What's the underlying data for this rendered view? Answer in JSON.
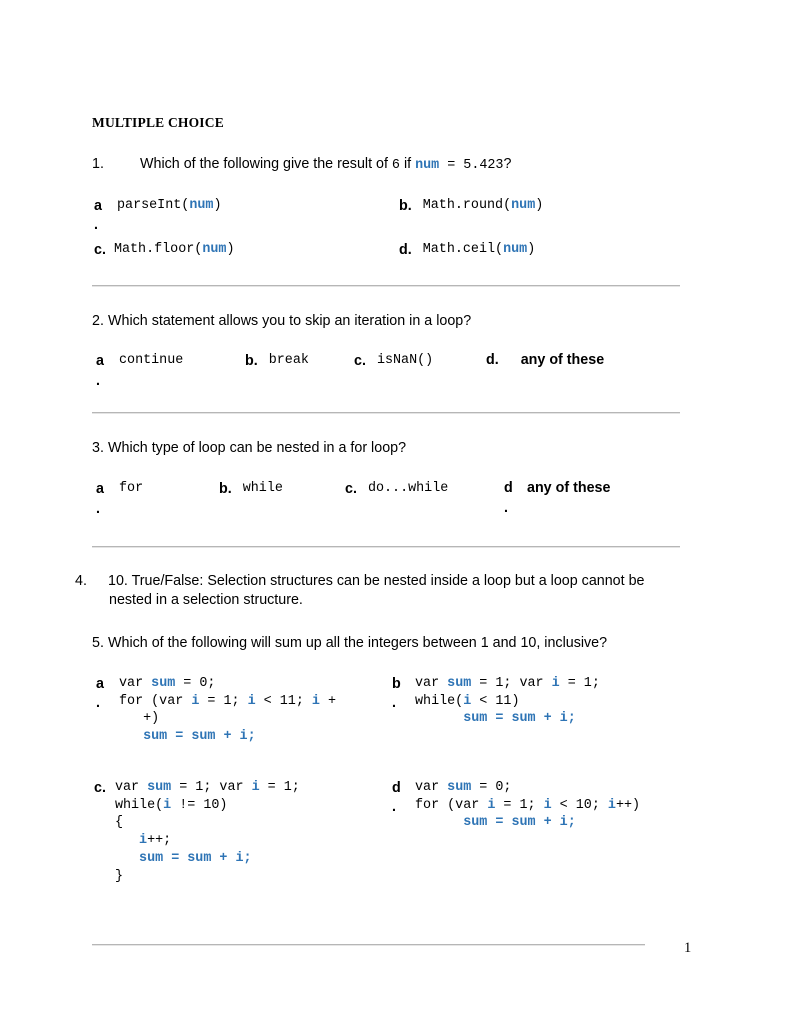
{
  "document": {
    "heading": "MULTIPLE CHOICE",
    "page_number": "1",
    "accent_color": "#2E74B5",
    "rule_color": "#b6b6b6"
  },
  "questions": [
    {
      "number": "1.",
      "prompt_parts": {
        "p1": "Which of the following give the result of ",
        "mono1": "6",
        "p2": "  if ",
        "kw1": "num",
        "mono2": " = 5.423",
        "p3": "?"
      },
      "options": [
        {
          "label": "a",
          "dot": ".",
          "code_plain_1": "parseInt(",
          "code_kw": "num",
          "code_plain_2": ")"
        },
        {
          "label": "b.",
          "code_plain_1": "Math.round(",
          "code_kw": "num",
          "code_plain_2": ")"
        },
        {
          "label": "c.",
          "code_plain_1": "Math.floor(",
          "code_kw": "num",
          "code_plain_2": ")"
        },
        {
          "label": "d.",
          "code_plain_1": "Math.ceil(",
          "code_kw": "num",
          "code_plain_2": ")"
        }
      ]
    },
    {
      "number": "2.",
      "prompt": "Which statement allows you to skip an iteration in a loop?",
      "options": [
        {
          "label": "a",
          "dot": ".",
          "text": "continue",
          "style": "mono"
        },
        {
          "label": "b.",
          "text": "break",
          "style": "mono"
        },
        {
          "label": "c.",
          "text": "isNaN()",
          "style": "mono"
        },
        {
          "label": "d.",
          "text": "any of these",
          "style": "plain"
        }
      ]
    },
    {
      "number": "3.",
      "prompt": "Which type of loop can be nested in a for loop?",
      "options": [
        {
          "label": "a",
          "dot": ".",
          "text": "for",
          "style": "mono"
        },
        {
          "label": "b.",
          "text": "while",
          "style": "mono"
        },
        {
          "label": "c.",
          "text": "do...while",
          "style": "mono"
        },
        {
          "label": "d",
          "dot": ".",
          "text": "any of these",
          "style": "plain"
        }
      ]
    },
    {
      "number": "4.",
      "prompt_line1": "10.  True/False:  Selection structures can be nested inside a loop but a loop cannot be",
      "prompt_line2": "nested in a selection structure."
    },
    {
      "number": "5.",
      "prompt": "Which of the following will sum up all the integers between 1 and 10, inclusive?",
      "options": [
        {
          "label": "a",
          "dot": ".",
          "lines": [
            [
              {
                "t": "var ",
                "k": false
              },
              {
                "t": "sum",
                "k": true
              },
              {
                "t": " = 0;",
                "k": false
              }
            ],
            [
              {
                "t": "for (var ",
                "k": false
              },
              {
                "t": "i",
                "k": true
              },
              {
                "t": " = 1; ",
                "k": false
              },
              {
                "t": "i",
                "k": true
              },
              {
                "t": " < 11; ",
                "k": false
              },
              {
                "t": "i",
                "k": true
              },
              {
                "t": " +",
                "k": false
              }
            ],
            [
              {
                "t": "   +)",
                "k": false
              }
            ],
            [
              {
                "t": "   ",
                "k": false
              },
              {
                "t": "sum",
                "k": true
              },
              {
                "t": " = ",
                "k": true
              },
              {
                "t": "sum",
                "k": true
              },
              {
                "t": " + ",
                "k": true
              },
              {
                "t": "i;",
                "k": true
              }
            ]
          ]
        },
        {
          "label": "b",
          "dot": ".",
          "lines": [
            [
              {
                "t": "var ",
                "k": false
              },
              {
                "t": "sum",
                "k": true
              },
              {
                "t": " = 1; var ",
                "k": false
              },
              {
                "t": "i",
                "k": true
              },
              {
                "t": " = 1;",
                "k": false
              }
            ],
            [
              {
                "t": "while(",
                "k": false
              },
              {
                "t": "i",
                "k": true
              },
              {
                "t": " < 11)",
                "k": false
              }
            ],
            [
              {
                "t": "      ",
                "k": false
              },
              {
                "t": "sum",
                "k": true
              },
              {
                "t": " = ",
                "k": true
              },
              {
                "t": "sum",
                "k": true
              },
              {
                "t": " + ",
                "k": true
              },
              {
                "t": "i;",
                "k": true
              }
            ]
          ]
        },
        {
          "label": "c.",
          "lines": [
            [
              {
                "t": "var ",
                "k": false
              },
              {
                "t": "sum",
                "k": true
              },
              {
                "t": " = 1; var ",
                "k": false
              },
              {
                "t": "i",
                "k": true
              },
              {
                "t": " = 1;",
                "k": false
              }
            ],
            [
              {
                "t": "while(",
                "k": false
              },
              {
                "t": "i",
                "k": true
              },
              {
                "t": " != 10)",
                "k": false
              }
            ],
            [
              {
                "t": "{",
                "k": false
              }
            ],
            [
              {
                "t": "   ",
                "k": false
              },
              {
                "t": "i",
                "k": true
              },
              {
                "t": "++;",
                "k": false
              }
            ],
            [
              {
                "t": "   ",
                "k": false
              },
              {
                "t": "sum",
                "k": true
              },
              {
                "t": " = ",
                "k": true
              },
              {
                "t": "sum",
                "k": true
              },
              {
                "t": " + ",
                "k": true
              },
              {
                "t": "i;",
                "k": true
              }
            ],
            [
              {
                "t": "}",
                "k": false
              }
            ]
          ]
        },
        {
          "label": "d",
          "dot": ".",
          "lines": [
            [
              {
                "t": "var ",
                "k": false
              },
              {
                "t": "sum",
                "k": true
              },
              {
                "t": " = 0;",
                "k": false
              }
            ],
            [
              {
                "t": "for (var ",
                "k": false
              },
              {
                "t": "i",
                "k": true
              },
              {
                "t": " = 1; ",
                "k": false
              },
              {
                "t": "i",
                "k": true
              },
              {
                "t": " < 10; ",
                "k": false
              },
              {
                "t": "i",
                "k": true
              },
              {
                "t": "++)",
                "k": false
              }
            ],
            [
              {
                "t": "      ",
                "k": false
              },
              {
                "t": "sum",
                "k": true
              },
              {
                "t": " = ",
                "k": true
              },
              {
                "t": "sum",
                "k": true
              },
              {
                "t": " + ",
                "k": true
              },
              {
                "t": "i;",
                "k": true
              }
            ]
          ]
        }
      ]
    }
  ]
}
